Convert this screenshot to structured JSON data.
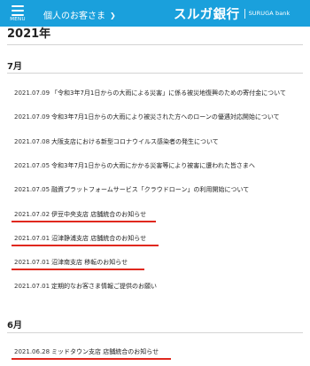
{
  "header": {
    "menu_label": "MENU",
    "audience_label": "個人のお客さま",
    "brand_jp": "スルガ銀行",
    "brand_en": "SURUGA bank",
    "bg_color": "#1aa0dc"
  },
  "archive": {
    "year": "2021年",
    "sections": [
      {
        "month": "7月",
        "items": [
          {
            "date": "2021.07.09",
            "title": "「令和3年7月1日からの大雨による災害」に係る被災地復興のための寄付金について"
          },
          {
            "date": "2021.07.09",
            "title": "令和3年7月1日からの大雨により被災された方へのローンの優遇対応開始について"
          },
          {
            "date": "2021.07.08",
            "title": "大阪支店における新型コロナウイルス感染者の発生について"
          },
          {
            "date": "2021.07.05",
            "title": "令和3年7月1日からの大雨にかかる災害等により被害に遭われた皆さまへ"
          },
          {
            "date": "2021.07.05",
            "title": "融資プラットフォームサービス「クラウドローン」の利用開始について"
          },
          {
            "date": "2021.07.02",
            "title": "伊豆中央支店 店舗統合のお知らせ"
          },
          {
            "date": "2021.07.01",
            "title": "沼津静浦支店 店舗統合のお知らせ"
          },
          {
            "date": "2021.07.01",
            "title": "沼津南支店 移転のお知らせ"
          },
          {
            "date": "2021.07.01",
            "title": "定期的なお客さま情報ご提供のお願い"
          }
        ]
      },
      {
        "month": "6月",
        "items": [
          {
            "date": "2021.06.28",
            "title": "ミッドタウン支店 店舗統合のお知らせ"
          }
        ]
      }
    ]
  },
  "highlight_color": "#e0281e"
}
